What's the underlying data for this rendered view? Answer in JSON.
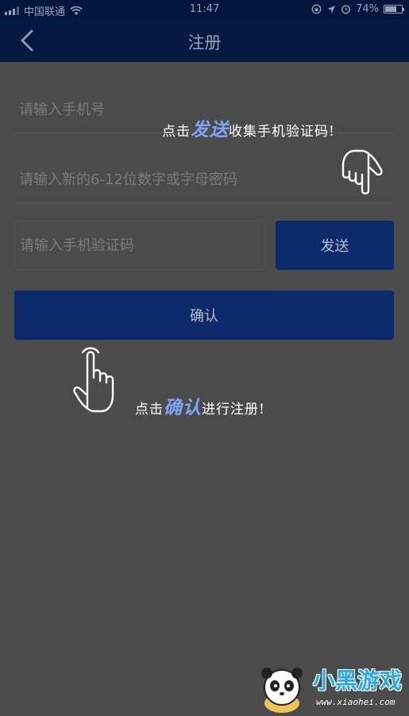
{
  "status_bar": {
    "carrier": "中国联通",
    "time": "11:47",
    "battery": "74%",
    "battery_level": 0.74
  },
  "nav": {
    "title": "注册"
  },
  "form": {
    "phone_placeholder": "请输入手机号",
    "password_placeholder": "请输入新的6-12位数字或字母密码",
    "code_placeholder": "请输入手机验证码",
    "send_label": "发送",
    "confirm_label": "确认"
  },
  "hints": {
    "send": {
      "prefix": "点击",
      "highlight": "发送",
      "suffix": "收集手机验证码!"
    },
    "confirm": {
      "prefix": "点击",
      "highlight": "确认",
      "suffix": "进行注册!"
    }
  },
  "watermark": {
    "brand": "小黑游戏",
    "url": "www.xiaohei.com"
  },
  "colors": {
    "background": "#4b4b4b",
    "nav_background": "#041a42",
    "button": "#0c2a69",
    "highlight": "#7ea4f6"
  },
  "icons": [
    "back-chevron-icon",
    "signal-icon",
    "wifi-icon",
    "location-icon",
    "alarm-icon",
    "battery-icon",
    "pointing-hand-icon",
    "panda-logo"
  ]
}
